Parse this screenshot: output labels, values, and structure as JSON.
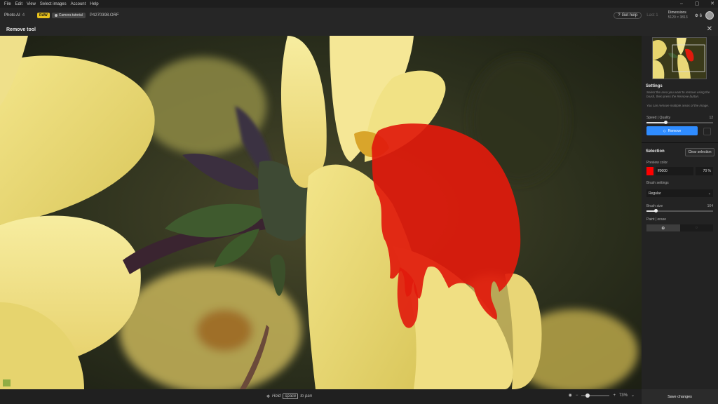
{
  "menu": [
    "File",
    "Edit",
    "View",
    "Select images",
    "Account",
    "Help"
  ],
  "window_controls": [
    "–",
    "▢",
    "✕"
  ],
  "app": {
    "title": "Photo AI",
    "version": "4",
    "badge_raw": "RAW",
    "badge_tutorial": "Camera tutorial",
    "filename": "P4270398.ORF"
  },
  "header_right": {
    "get_help": "Get help",
    "last": "Last 1",
    "dimensions_label": "Dimensions",
    "dimensions_value": "5120 × 3813",
    "count": "6"
  },
  "tool": {
    "title": "Remove tool",
    "close": "✕"
  },
  "canvas": {
    "pan_hint_pre": "Hold",
    "pan_hint_key": "space",
    "pan_hint_post": "to pan",
    "zoom": "73%",
    "zoom_level": 0.15
  },
  "panel": {
    "settings_title": "Settings",
    "settings_help_1": "Select the area you want to remove using the brush, then press the Remove button.",
    "settings_help_2": "You can remove multiple areas of the image.",
    "speed_label": "Speed | Quality",
    "speed_value": "12",
    "speed_level": 0.28,
    "remove_label": "Remove",
    "selection_title": "Selection",
    "clear_selection": "Clear selection",
    "preview_color_label": "Preview color",
    "preview_color_hex": "ff0000",
    "preview_opacity": "70 %",
    "brush_settings_label": "Brush settings",
    "brush_mode": "Regular",
    "brush_size_label": "Brush size",
    "brush_size_value": "164",
    "brush_size_level": 0.14,
    "paint_erase_label": "Paint | erase",
    "save_changes": "Save changes"
  },
  "colors": {
    "accent": "#2f8cff",
    "selection": "#ff0000",
    "raw_badge": "#e8c21d"
  }
}
